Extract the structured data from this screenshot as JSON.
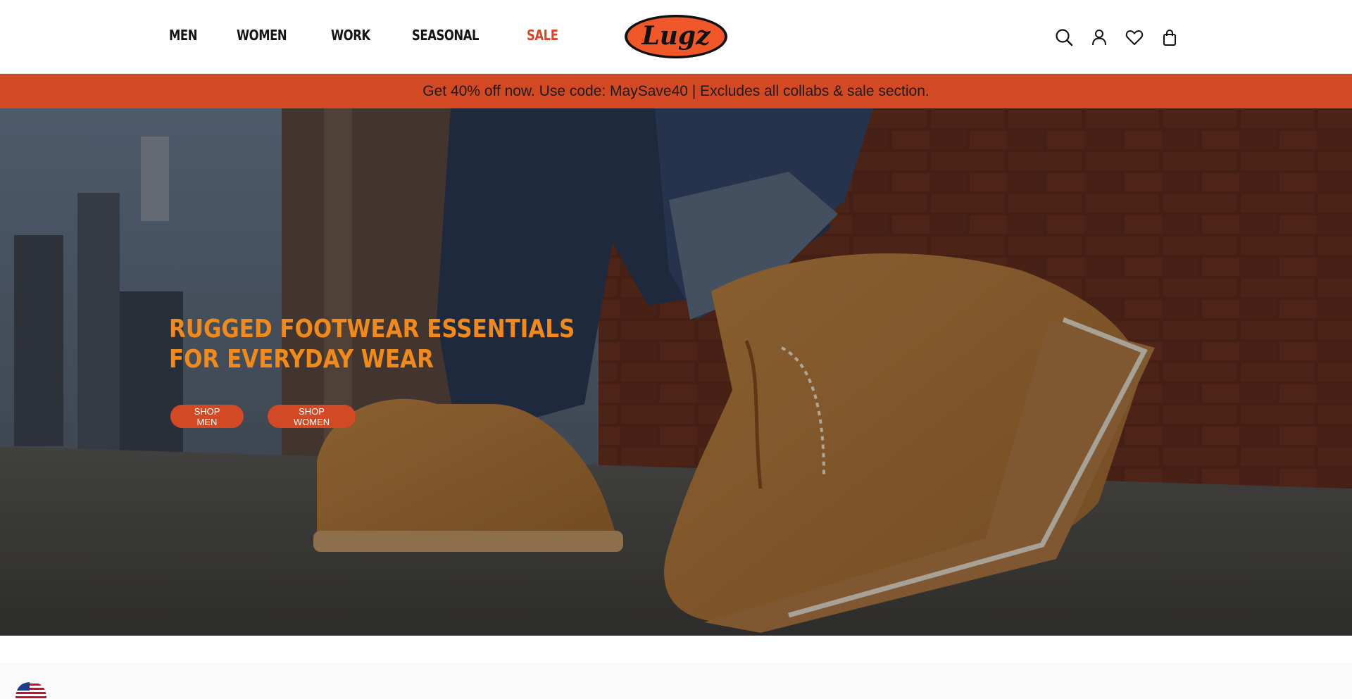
{
  "header": {
    "nav": [
      "MEN",
      "WOMEN",
      "WORK",
      "SEASONAL",
      "SALE"
    ],
    "logo_text": "Lugz",
    "icons": [
      "search-icon",
      "account-icon",
      "wishlist-heart-icon",
      "cart-bag-icon"
    ]
  },
  "promo": {
    "text": "Get 40% off now. Use code: MaySave40 | Excludes all collabs & sale section."
  },
  "hero": {
    "title_line1": "RUGGED FOOTWEAR ESSENTIALS",
    "title_line2": "FOR EVERYDAY WEAR",
    "btn_men": "SHOP MEN",
    "btn_women": "SHOP WOMEN"
  },
  "colors": {
    "accent": "#d24924",
    "sale": "#d4472a",
    "hero_title": "#f08a1c",
    "logo_fill": "#f0582a"
  }
}
